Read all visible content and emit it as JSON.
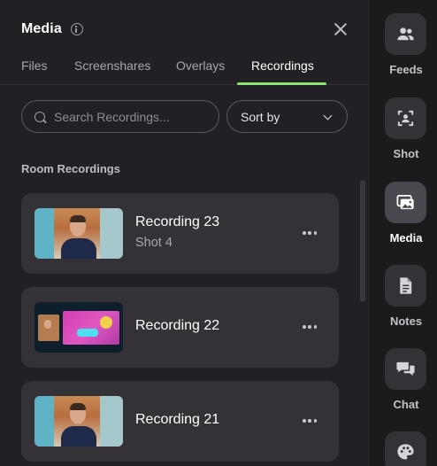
{
  "panel": {
    "title": "Media",
    "tabs": [
      {
        "label": "Files"
      },
      {
        "label": "Screenshares"
      },
      {
        "label": "Overlays"
      },
      {
        "label": "Recordings"
      }
    ],
    "active_tab": "Recordings",
    "search": {
      "placeholder": "Search Recordings...",
      "value": ""
    },
    "sort": {
      "label": "Sort by"
    },
    "section_title": "Room Recordings",
    "recordings": [
      {
        "name": "Recording 23",
        "subtitle": "Shot 4"
      },
      {
        "name": "Recording 22",
        "subtitle": ""
      },
      {
        "name": "Recording 21",
        "subtitle": ""
      }
    ]
  },
  "rail": {
    "items": [
      {
        "label": "Feeds",
        "icon": "people-icon"
      },
      {
        "label": "Shot",
        "icon": "portrait-frame-icon"
      },
      {
        "label": "Media",
        "icon": "images-icon",
        "active": true
      },
      {
        "label": "Notes",
        "icon": "document-icon"
      },
      {
        "label": "Chat",
        "icon": "chat-bubbles-icon"
      },
      {
        "label": "",
        "icon": "palette-icon"
      }
    ]
  },
  "colors": {
    "accent": "#8de46f",
    "background": "#222024",
    "card": "#343237"
  }
}
